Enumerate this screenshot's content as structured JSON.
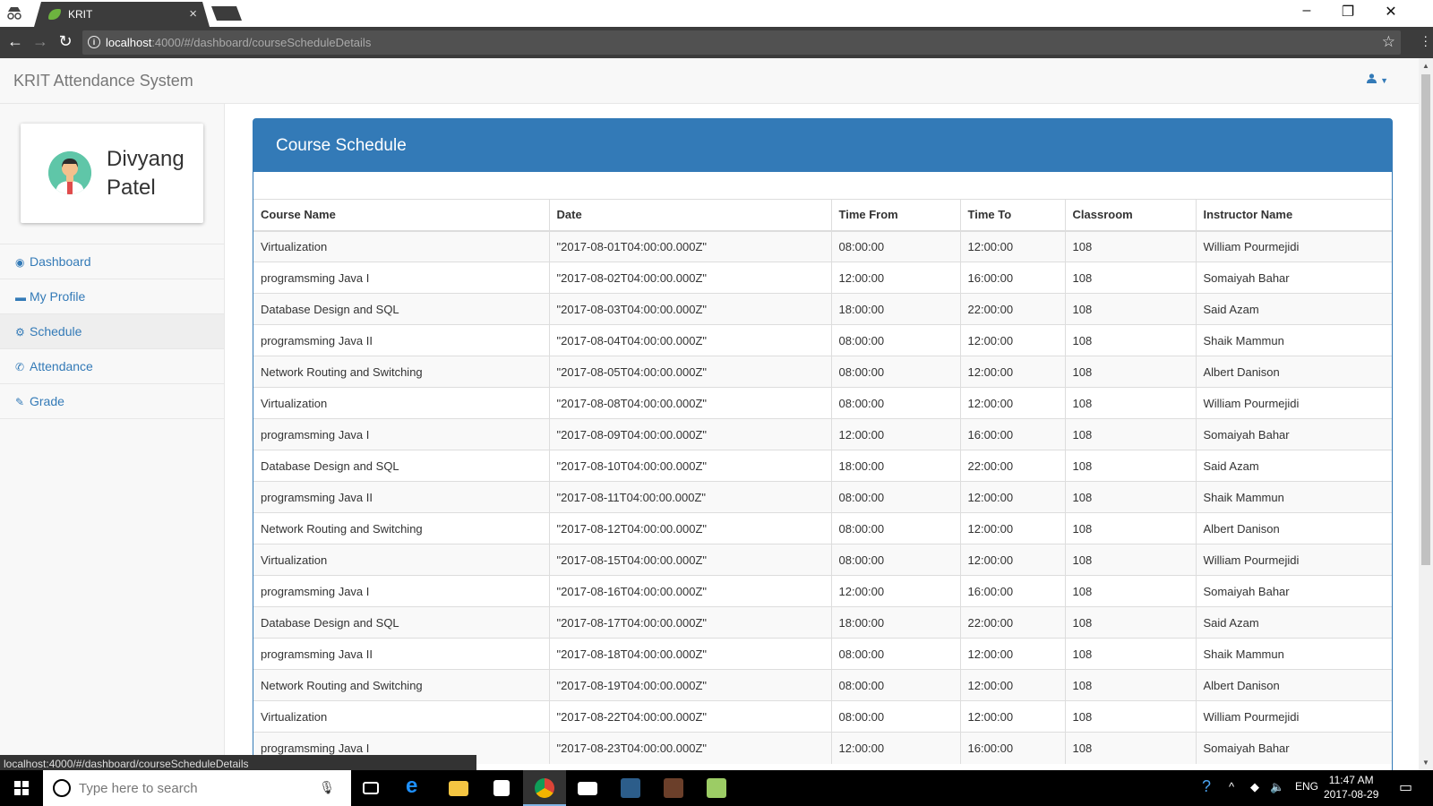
{
  "browser": {
    "tab_title": "KRIT",
    "url_host": "localhost",
    "url_path": ":4000/#/dashboard/courseScheduleDetails",
    "status_url": "localhost:4000/#/dashboard/courseScheduleDetails"
  },
  "app": {
    "brand": "KRIT Attendance System",
    "user_first": "Divyang",
    "user_last": "Patel",
    "nav": [
      {
        "label": "Dashboard",
        "icon": "dashboard-icon"
      },
      {
        "label": "My Profile",
        "icon": "profile-icon"
      },
      {
        "label": "Schedule",
        "icon": "cogs-icon",
        "active": true
      },
      {
        "label": "Attendance",
        "icon": "phone-icon"
      },
      {
        "label": "Grade",
        "icon": "edit-icon"
      }
    ]
  },
  "panel": {
    "title": "Course Schedule",
    "headers": [
      "Course Name",
      "Date",
      "Time From",
      "Time To",
      "Classroom",
      "Instructor Name"
    ],
    "rows": [
      [
        "Virtualization",
        "\"2017-08-01T04:00:00.000Z\"",
        "08:00:00",
        "12:00:00",
        "108",
        "William Pourmejidi"
      ],
      [
        "programsming Java I",
        "\"2017-08-02T04:00:00.000Z\"",
        "12:00:00",
        "16:00:00",
        "108",
        "Somaiyah Bahar"
      ],
      [
        "Database Design and SQL",
        "\"2017-08-03T04:00:00.000Z\"",
        "18:00:00",
        "22:00:00",
        "108",
        "Said Azam"
      ],
      [
        "programsming Java II",
        "\"2017-08-04T04:00:00.000Z\"",
        "08:00:00",
        "12:00:00",
        "108",
        "Shaik Mammun"
      ],
      [
        "Network Routing and Switching",
        "\"2017-08-05T04:00:00.000Z\"",
        "08:00:00",
        "12:00:00",
        "108",
        "Albert Danison"
      ],
      [
        "Virtualization",
        "\"2017-08-08T04:00:00.000Z\"",
        "08:00:00",
        "12:00:00",
        "108",
        "William Pourmejidi"
      ],
      [
        "programsming Java I",
        "\"2017-08-09T04:00:00.000Z\"",
        "12:00:00",
        "16:00:00",
        "108",
        "Somaiyah Bahar"
      ],
      [
        "Database Design and SQL",
        "\"2017-08-10T04:00:00.000Z\"",
        "18:00:00",
        "22:00:00",
        "108",
        "Said Azam"
      ],
      [
        "programsming Java II",
        "\"2017-08-11T04:00:00.000Z\"",
        "08:00:00",
        "12:00:00",
        "108",
        "Shaik Mammun"
      ],
      [
        "Network Routing and Switching",
        "\"2017-08-12T04:00:00.000Z\"",
        "08:00:00",
        "12:00:00",
        "108",
        "Albert Danison"
      ],
      [
        "Virtualization",
        "\"2017-08-15T04:00:00.000Z\"",
        "08:00:00",
        "12:00:00",
        "108",
        "William Pourmejidi"
      ],
      [
        "programsming Java I",
        "\"2017-08-16T04:00:00.000Z\"",
        "12:00:00",
        "16:00:00",
        "108",
        "Somaiyah Bahar"
      ],
      [
        "Database Design and SQL",
        "\"2017-08-17T04:00:00.000Z\"",
        "18:00:00",
        "22:00:00",
        "108",
        "Said Azam"
      ],
      [
        "programsming Java II",
        "\"2017-08-18T04:00:00.000Z\"",
        "08:00:00",
        "12:00:00",
        "108",
        "Shaik Mammun"
      ],
      [
        "Network Routing and Switching",
        "\"2017-08-19T04:00:00.000Z\"",
        "08:00:00",
        "12:00:00",
        "108",
        "Albert Danison"
      ],
      [
        "Virtualization",
        "\"2017-08-22T04:00:00.000Z\"",
        "08:00:00",
        "12:00:00",
        "108",
        "William Pourmejidi"
      ],
      [
        "programsming Java I",
        "\"2017-08-23T04:00:00.000Z\"",
        "12:00:00",
        "16:00:00",
        "108",
        "Somaiyah Bahar"
      ]
    ]
  },
  "taskbar": {
    "search_placeholder": "Type here to search",
    "lang": "ENG",
    "time": "11:47 AM",
    "date": "2017-08-29"
  },
  "colors": {
    "primary": "#337ab7",
    "chrome_dark": "#3c3c3c"
  }
}
